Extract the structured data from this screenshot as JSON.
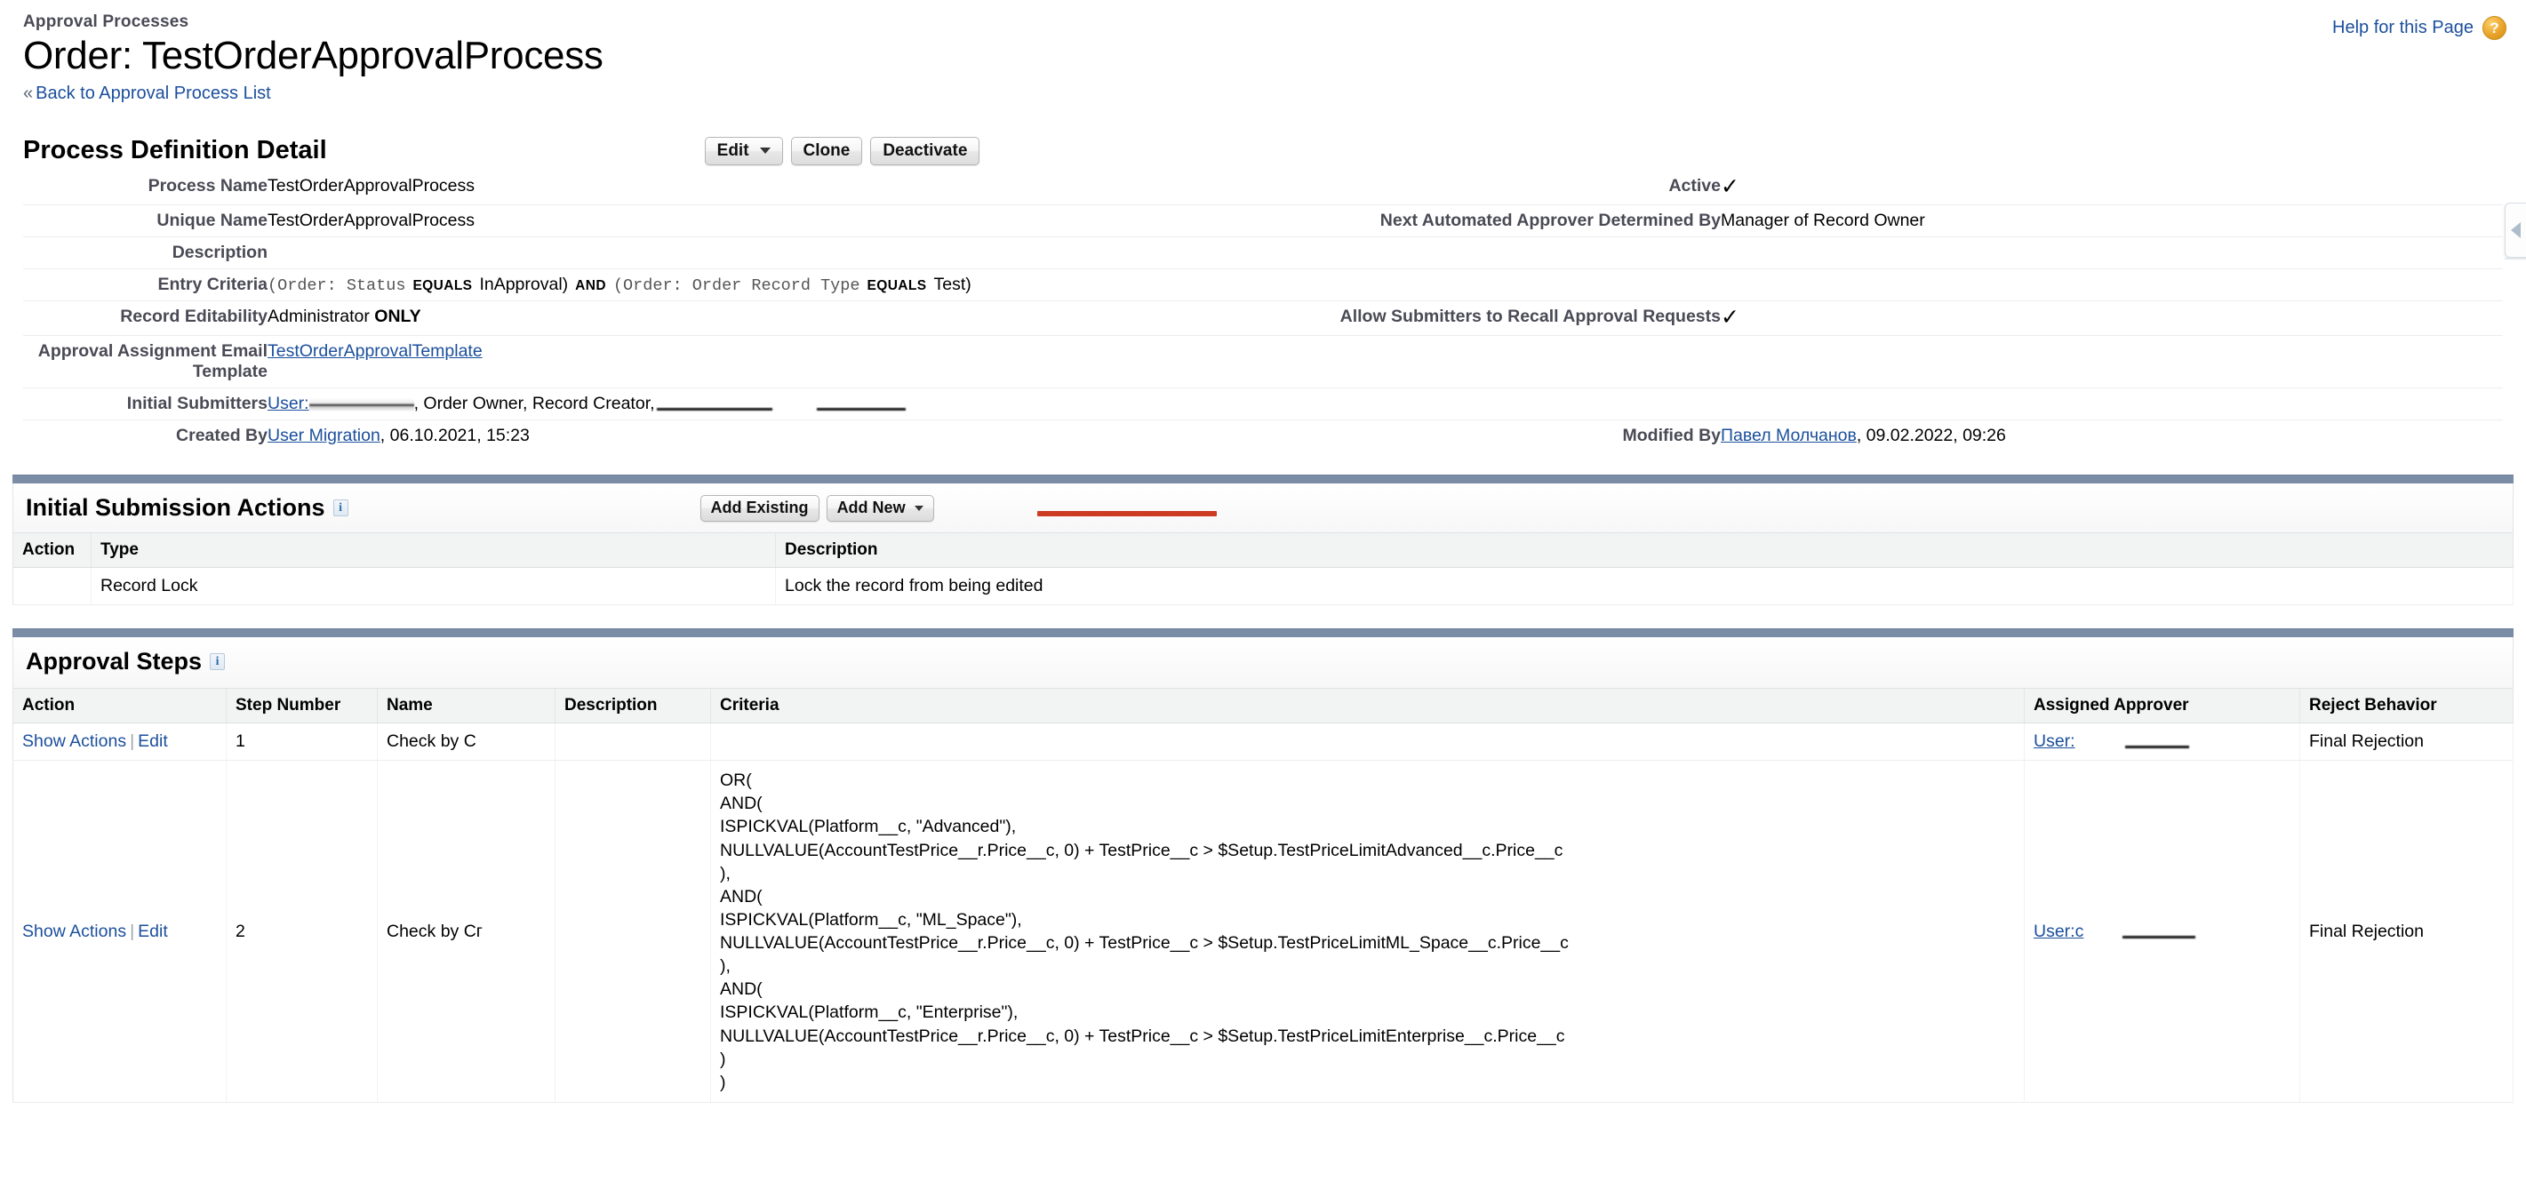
{
  "header": {
    "breadcrumb": "Approval Processes",
    "title": "Order: TestOrderApprovalProcess",
    "back_chevron": "«",
    "back_link": "Back to Approval Process List",
    "help_link": "Help for this Page",
    "help_badge": "?"
  },
  "detail": {
    "title": "Process Definition Detail",
    "buttons": [
      {
        "label": "Edit",
        "has_caret": true
      },
      {
        "label": "Clone",
        "has_caret": false
      },
      {
        "label": "Deactivate",
        "has_caret": false
      }
    ],
    "fields": {
      "process_name_label": "Process Name",
      "process_name_value": "TestOrderApprovalProcess",
      "active_label": "Active",
      "active_value": "✓",
      "unique_name_label": "Unique Name",
      "unique_name_value": "TestOrderApprovalProcess",
      "next_approver_label": "Next Automated Approver Determined By",
      "next_approver_value": "Manager of Record Owner",
      "description_label": "Description",
      "description_value": "",
      "entry_criteria_label": "Entry Criteria",
      "entry_criteria_parts": {
        "p1": "(",
        "p2": "Order: Status",
        "p3": "EQUALS",
        "p4": "InApproval)",
        "p5": "AND",
        "p6": "(",
        "p7": "Order: Order Record Type",
        "p8": "EQUALS",
        "p9": "Test)"
      },
      "record_editability_label": "Record Editability",
      "record_editability_value": "Administrator",
      "record_editability_value_bold": "ONLY",
      "allow_recall_label": "Allow Submitters to Recall Approval Requests",
      "allow_recall_value": "✓",
      "email_template_label": "Approval Assignment Email Template",
      "email_template_value": "TestOrderApprovalTemplate",
      "initial_submitters_label": "Initial Submitters",
      "initial_submitters_prefix": "User:",
      "initial_submitters_rest": ", Order Owner, Record Creator,",
      "created_by_label": "Created By",
      "created_by_user": "User Migration",
      "created_by_rest": ", 06.10.2021, 15:23",
      "modified_by_label": "Modified By",
      "modified_by_user": "Павел Молчанов",
      "modified_by_rest": ", 09.02.2022, 09:26"
    }
  },
  "initial_submission_actions": {
    "title": "Initial Submission Actions",
    "info_icon": "i",
    "buttons": [
      {
        "label": "Add Existing",
        "has_caret": false
      },
      {
        "label": "Add New",
        "has_caret": true
      }
    ],
    "columns": [
      "Action",
      "Type",
      "Description"
    ],
    "rows": [
      {
        "action": "",
        "type": "Record Lock",
        "description": "Lock the record from being edited"
      }
    ]
  },
  "approval_steps": {
    "title": "Approval Steps",
    "info_icon": "i",
    "columns": [
      "Action",
      "Step Number",
      "Name",
      "Description",
      "Criteria",
      "Assigned Approver",
      "Reject Behavior"
    ],
    "action_show": "Show Actions",
    "action_sep": "|",
    "action_edit": "Edit",
    "rows": [
      {
        "step_number": "1",
        "name": "Check by C",
        "description": "",
        "criteria": "",
        "approver_prefix": "User:",
        "reject_behavior": "Final Rejection"
      },
      {
        "step_number": "2",
        "name": "Check by Cг",
        "description": "",
        "criteria": "OR(\nAND(\nISPICKVAL(Platform__c, \"Advanced\"),\nNULLVALUE(AccountTestPrice__r.Price__c, 0) + TestPrice__c > $Setup.TestPriceLimitAdvanced__c.Price__c\n),\nAND(\nISPICKVAL(Platform__c, \"ML_Space\"),\nNULLVALUE(AccountTestPrice__r.Price__c, 0) + TestPrice__c > $Setup.TestPriceLimitML_Space__c.Price__c\n),\nAND(\nISPICKVAL(Platform__c, \"Enterprise\"),\nNULLVALUE(AccountTestPrice__r.Price__c, 0) + TestPrice__c > $Setup.TestPriceLimitEnterprise__c.Price__c\n)\n)",
        "approver_prefix": "User:с",
        "reject_behavior": "Final Rejection"
      }
    ]
  },
  "colors": {
    "link": "#1b4f9c",
    "panel_bar": "#7b8ca6",
    "annotation_red": "#cc3b22",
    "label_gray": "#4a4a56"
  }
}
